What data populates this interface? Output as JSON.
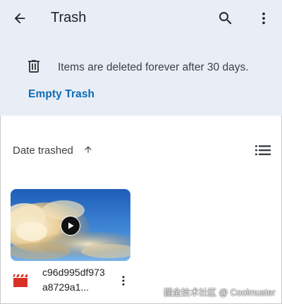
{
  "app_bar": {
    "title": "Trash",
    "icons": {
      "back": "arrow-back-icon",
      "search": "search-icon",
      "more": "more-vert-icon"
    }
  },
  "banner": {
    "message": "Items are deleted forever after 30 days.",
    "action_label": "Empty Trash",
    "icon": "trash-can-icon"
  },
  "sort": {
    "label": "Date trashed",
    "direction_icon": "arrow-up-icon",
    "view_toggle_icon": "list-view-icon"
  },
  "files": [
    {
      "name": "c96d995df973a8729a1...",
      "type_icon": "video-clapper-icon",
      "thumbnail_icon": "play-icon"
    }
  ],
  "watermark": "掘金技术社区 @ Coolmuster",
  "colors": {
    "header_bg": "#e9eef6",
    "accent": "#0b6bb6",
    "file_icon": "#d93025",
    "text_primary": "#202124"
  }
}
